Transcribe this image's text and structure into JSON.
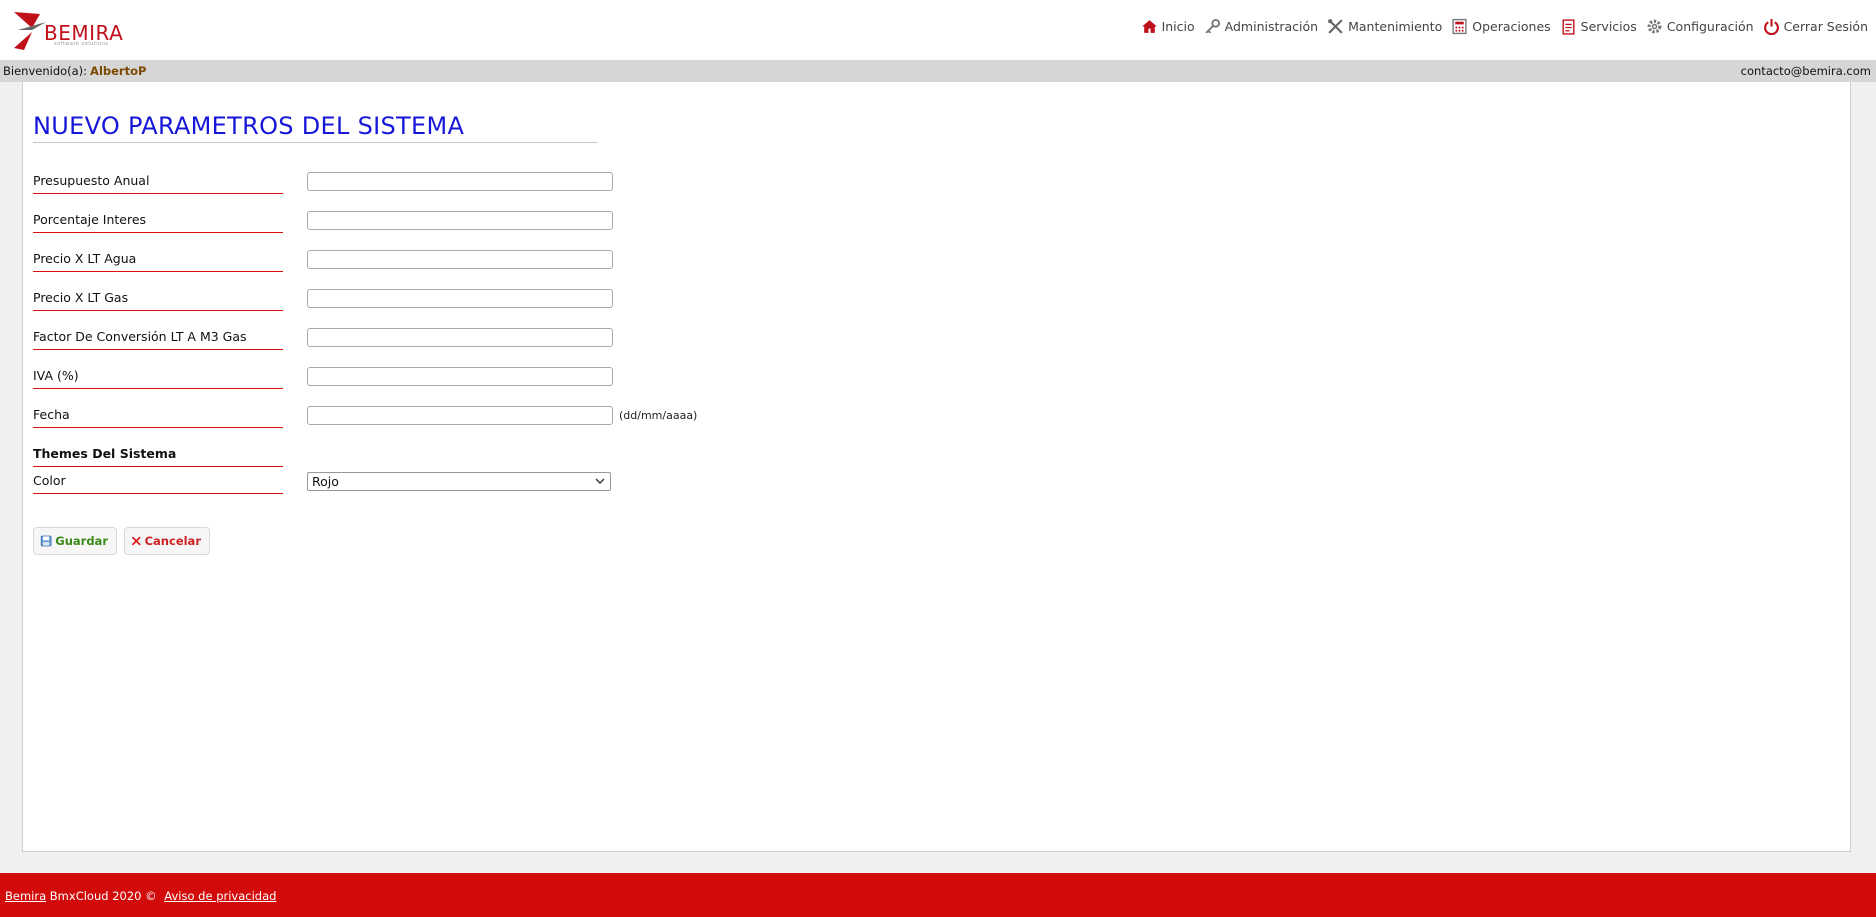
{
  "brand": {
    "name": "BEMIRA",
    "tagline": "software solutions"
  },
  "nav": [
    {
      "label": "Inicio",
      "icon": "home-icon"
    },
    {
      "label": "Administración",
      "icon": "key-icon"
    },
    {
      "label": "Mantenimiento",
      "icon": "tools-icon"
    },
    {
      "label": "Operaciones",
      "icon": "calculator-icon"
    },
    {
      "label": "Servicios",
      "icon": "clipboard-icon"
    },
    {
      "label": "Configuración",
      "icon": "gear-icon"
    },
    {
      "label": "Cerrar Sesión",
      "icon": "power-icon"
    }
  ],
  "welcome": {
    "prefix": "Bienvenido(a):",
    "user": "AlbertoP",
    "contact": "contacto@bemira.com"
  },
  "page": {
    "title": "NUEVO PARAMETROS DEL SISTEMA"
  },
  "form": {
    "fields": [
      {
        "label": "Presupuesto Anual",
        "value": ""
      },
      {
        "label": "Porcentaje Interes",
        "value": ""
      },
      {
        "label": "Precio X LT Agua",
        "value": ""
      },
      {
        "label": "Precio X LT Gas",
        "value": ""
      },
      {
        "label": "Factor De Conversión LT A M3 Gas",
        "value": ""
      },
      {
        "label": "IVA (%)",
        "value": ""
      },
      {
        "label": "Fecha",
        "value": "",
        "hint": "(dd/mm/aaaa)"
      }
    ],
    "themes_heading": "Themes Del Sistema",
    "color": {
      "label": "Color",
      "selected": "Rojo"
    }
  },
  "buttons": {
    "save": "Guardar",
    "cancel": "Cancelar"
  },
  "footer": {
    "brand_link": "Bemira",
    "copyright": "BmxCloud 2020 ©",
    "privacy": "Aviso de privacidad"
  },
  "colors": {
    "accent_red": "#d20a0a",
    "title_blue": "#1717d8",
    "save_green": "#3a8a1a"
  }
}
